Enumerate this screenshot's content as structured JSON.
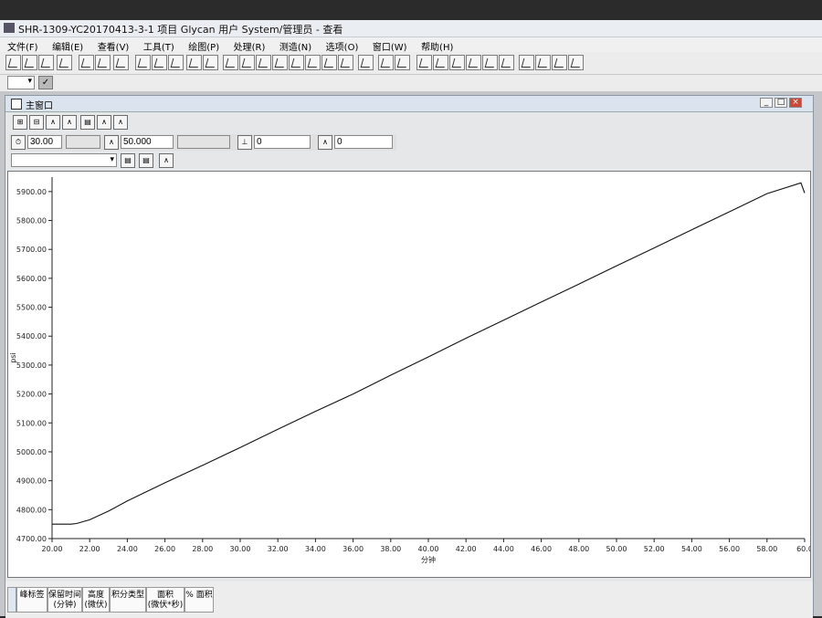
{
  "window": {
    "title": "SHR-1309-YC20170413-3-1 项目 Glycan 用户 System/管理员 - 查看"
  },
  "menu": {
    "items": [
      "文件(F)",
      "编辑(E)",
      "查看(V)",
      "工具(T)",
      "绘图(P)",
      "处理(R)",
      "测造(N)",
      "选项(O)",
      "窗口(W)",
      "帮助(H)"
    ]
  },
  "child_window": {
    "title": "主窗口"
  },
  "controls": {
    "time_start": "30.00",
    "time_end": "50.000",
    "threshold": "0",
    "offset": "0"
  },
  "table_headers": [
    "峰标签",
    "保留时间\n(分钟)",
    "高度\n(微伏)",
    "积分类型",
    "面积\n(微伏*秒)",
    "% 面积"
  ],
  "chart_data": {
    "type": "line",
    "xlabel": "分钟",
    "ylabel": "psi",
    "xlim": [
      20,
      60
    ],
    "ylim": [
      4700,
      5950
    ],
    "x_ticks": [
      "20.00",
      "22.00",
      "24.00",
      "26.00",
      "28.00",
      "30.00",
      "32.00",
      "34.00",
      "36.00",
      "38.00",
      "40.00",
      "42.00",
      "44.00",
      "46.00",
      "48.00",
      "50.00",
      "52.00",
      "54.00",
      "56.00",
      "58.00",
      "60.0"
    ],
    "y_ticks": [
      "4700.00",
      "4800.00",
      "4900.00",
      "5000.00",
      "5100.00",
      "5200.00",
      "5300.00",
      "5400.00",
      "5500.00",
      "5600.00",
      "5700.00",
      "5800.00",
      "5900.00"
    ],
    "series": [
      {
        "x": [
          20.0,
          21.0,
          21.3,
          22.0,
          23.0,
          24.0,
          26.0,
          28.0,
          30.0,
          32.0,
          34.0,
          36.0,
          38.0,
          40.0,
          42.0,
          44.0,
          46.0,
          48.0,
          50.0,
          52.0,
          54.0,
          56.0,
          58.0,
          59.8,
          60.0
        ],
        "y": [
          4750,
          4750,
          4752,
          4765,
          4795,
          4830,
          4893,
          4953,
          5015,
          5078,
          5140,
          5200,
          5265,
          5328,
          5393,
          5455,
          5518,
          5580,
          5643,
          5705,
          5768,
          5830,
          5893,
          5930,
          5895
        ]
      }
    ],
    "grid": false,
    "color": "#111111"
  }
}
